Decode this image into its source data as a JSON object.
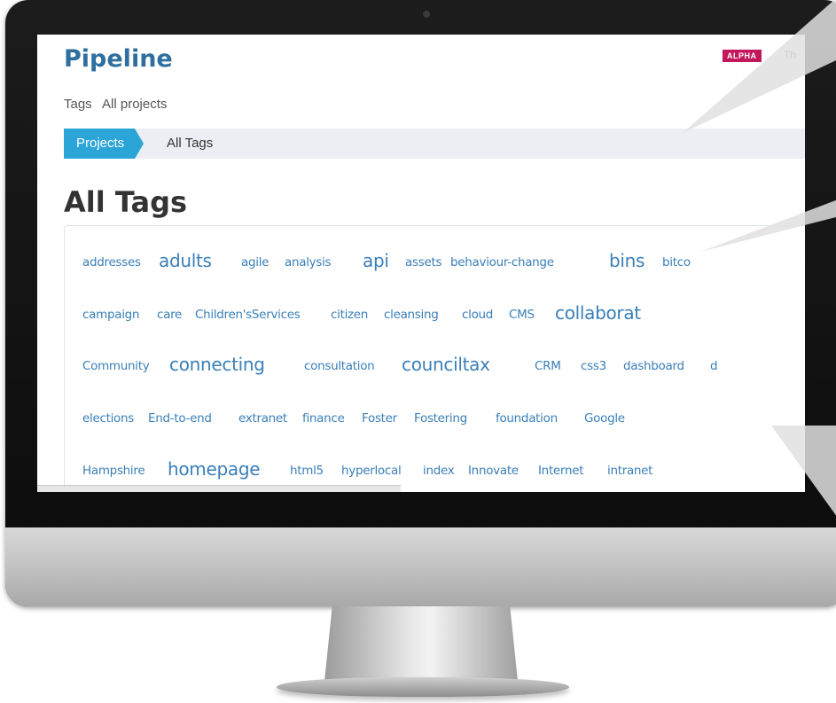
{
  "header": {
    "title": "Pipeline",
    "badge": "ALPHA",
    "trailing_text": "Th"
  },
  "nav": {
    "items": [
      "Tags",
      "All projects"
    ]
  },
  "breadcrumb": {
    "active": "Projects",
    "current": "All Tags"
  },
  "page": {
    "heading": "All Tags"
  },
  "tags": {
    "row1": [
      "addresses",
      "adults",
      "agile",
      "analysis",
      "api",
      "assets",
      "behaviour-change",
      "bins",
      "bitco"
    ],
    "row2": [
      "campaign",
      "care",
      "Children'sServices",
      "citizen",
      "cleansing",
      "cloud",
      "CMS",
      "collaborat"
    ],
    "row3": [
      "Community",
      "connecting",
      "consultation",
      "counciltax",
      "CRM",
      "css3",
      "dashboard",
      "d"
    ],
    "row4": [
      "elections",
      "End-to-end",
      "extranet",
      "finance",
      "Foster",
      "Fostering",
      "foundation",
      "Google"
    ],
    "row5": [
      "Hampshire",
      "homepage",
      "html5",
      "hyperlocal",
      "index",
      "Innovate",
      "Internet",
      "intranet"
    ]
  }
}
